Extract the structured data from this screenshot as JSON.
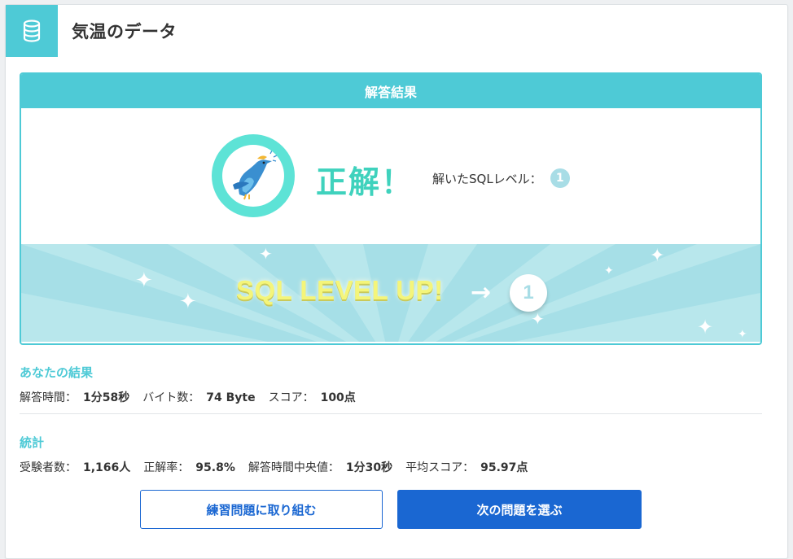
{
  "header": {
    "title": "気温のデータ",
    "icon": "database-icon"
  },
  "result": {
    "heading": "解答結果",
    "verdict": "正解！",
    "sql_level_label": "解いたSQLレベル：",
    "sql_level": "1",
    "banner": {
      "text": "SQL LEVEL UP!",
      "arrow": "→",
      "level": "1"
    }
  },
  "your_result": {
    "title": "あなたの結果",
    "items": [
      {
        "label": "解答時間：",
        "value": "1分58秒"
      },
      {
        "label": "バイト数：",
        "value": "74 Byte"
      },
      {
        "label": "スコア：",
        "value": "100点"
      }
    ]
  },
  "stats": {
    "title": "統計",
    "items": [
      {
        "label": "受験者数：",
        "value": "1,166人"
      },
      {
        "label": "正解率：",
        "value": "95.8%"
      },
      {
        "label": "解答時間中央値：",
        "value": "1分30秒"
      },
      {
        "label": "平均スコア：",
        "value": "95.97点"
      }
    ]
  },
  "buttons": {
    "practice": "練習問題に取り組む",
    "next": "次の問題を選ぶ"
  },
  "colors": {
    "accent": "#4ecad6",
    "correct": "#3fd2bd",
    "primary": "#1a67d2",
    "banner": "#a6dfe7"
  }
}
